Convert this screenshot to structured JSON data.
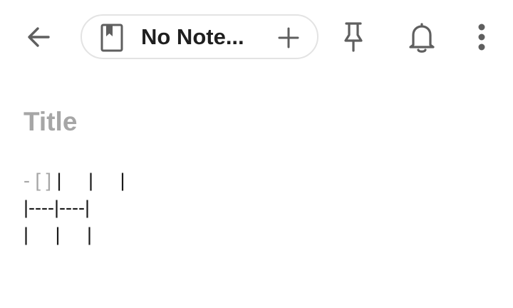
{
  "toolbar": {
    "back_icon": "arrow-left-icon",
    "notebook_chip": {
      "icon": "notebook-bookmark-icon",
      "label": "No Note...",
      "add_icon": "plus-icon"
    },
    "pin_icon": "pin-icon",
    "reminder_icon": "bell-icon",
    "more_icon": "more-vertical-icon"
  },
  "note": {
    "title_placeholder": "Title",
    "lines": [
      {
        "prefix": "- [ ] ",
        "text": "|     |     |"
      },
      {
        "prefix": "",
        "text": "|----|----|"
      },
      {
        "prefix": "",
        "text": "|     |     |"
      }
    ]
  },
  "colors": {
    "icon_gray": "#5f5f5f",
    "chip_border": "#e3e3e3",
    "placeholder_gray": "#a6a6a6",
    "text_dark": "#1a1a1a"
  }
}
